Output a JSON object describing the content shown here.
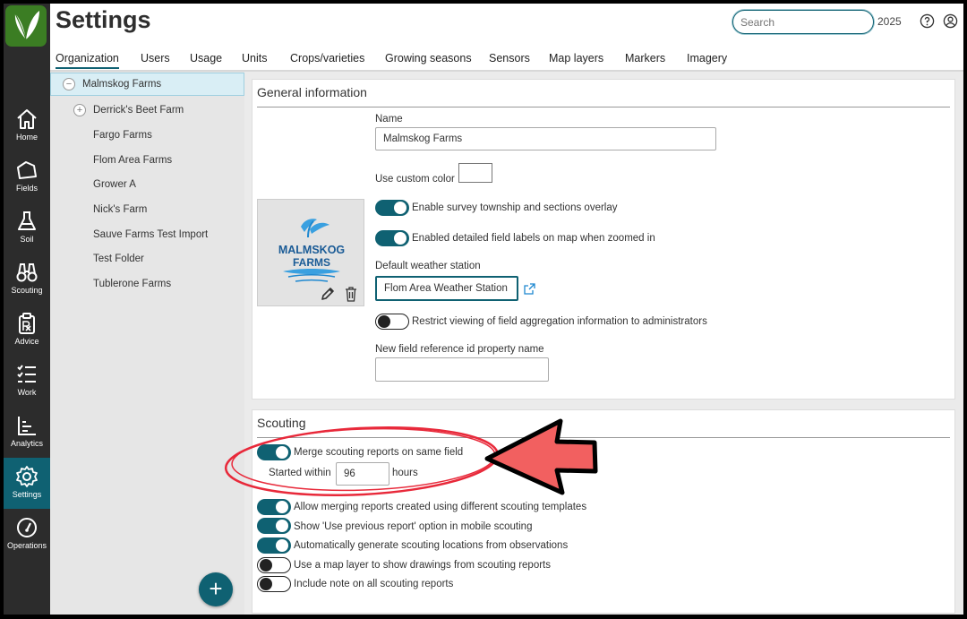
{
  "header": {
    "title": "Settings",
    "search_placeholder": "Search",
    "year": "2025"
  },
  "nav": [
    {
      "label": "Home",
      "icon": "home-icon"
    },
    {
      "label": "Fields",
      "icon": "field-icon"
    },
    {
      "label": "Soil",
      "icon": "flask-icon"
    },
    {
      "label": "Scouting",
      "icon": "binoculars-icon"
    },
    {
      "label": "Advice",
      "icon": "prescription-icon"
    },
    {
      "label": "Work",
      "icon": "checklist-icon"
    },
    {
      "label": "Analytics",
      "icon": "bar-chart-icon"
    },
    {
      "label": "Settings",
      "icon": "gear-icon",
      "active": true
    },
    {
      "label": "Operations",
      "icon": "gauge-icon"
    }
  ],
  "tabs": [
    {
      "label": "Organization",
      "active": true
    },
    {
      "label": "Users"
    },
    {
      "label": "Usage"
    },
    {
      "label": "Units"
    },
    {
      "label": "Crops/varieties"
    },
    {
      "label": "Growing seasons"
    },
    {
      "label": "Sensors"
    },
    {
      "label": "Map layers"
    },
    {
      "label": "Markers"
    },
    {
      "label": "Imagery"
    }
  ],
  "tree": [
    {
      "label": "Malmskog Farms",
      "expander": "−",
      "selected": true
    },
    {
      "label": "Derrick's Beet Farm",
      "expander": "+"
    },
    {
      "label": "Fargo Farms"
    },
    {
      "label": "Flom Area Farms"
    },
    {
      "label": "Grower A"
    },
    {
      "label": "Nick's Farm"
    },
    {
      "label": "Sauve Farms Test Import"
    },
    {
      "label": "Test Folder"
    },
    {
      "label": "Tublerone Farms"
    }
  ],
  "general": {
    "title": "General information",
    "name_label": "Name",
    "name_value": "Malmskog Farms",
    "custom_color_label": "Use custom color",
    "logo_text_1": "MALMSKOG",
    "logo_text_2": "FARMS",
    "survey_overlay": {
      "label": "Enable survey township and sections overlay",
      "on": true
    },
    "field_labels": {
      "label": "Enabled detailed field labels on map when zoomed in",
      "on": true
    },
    "weather_label": "Default weather station",
    "weather_value": "Flom Area Weather Station",
    "restrict_aggregation": {
      "label": "Restrict viewing of field aggregation information to administrators",
      "on": false
    },
    "ref_id_label": "New field reference id property name",
    "ref_id_value": ""
  },
  "scouting": {
    "title": "Scouting",
    "merge": {
      "label": "Merge scouting reports on same field",
      "on": true
    },
    "started_within_label": "Started within",
    "started_within_value": "96",
    "hours_label": "hours",
    "options": [
      {
        "label": "Allow merging reports created using different scouting templates",
        "on": true
      },
      {
        "label": "Show 'Use previous report' option in mobile scouting",
        "on": true
      },
      {
        "label": "Automatically generate scouting locations from observations",
        "on": true
      },
      {
        "label": "Use a map layer to show drawings from scouting reports",
        "on": false
      },
      {
        "label": "Include note on all scouting reports",
        "on": false
      }
    ]
  },
  "colors": {
    "accent": "#0f6172",
    "nav_bg": "#2c2c2c",
    "annotation": "#e8293a",
    "arrow_fill": "#f26060"
  }
}
